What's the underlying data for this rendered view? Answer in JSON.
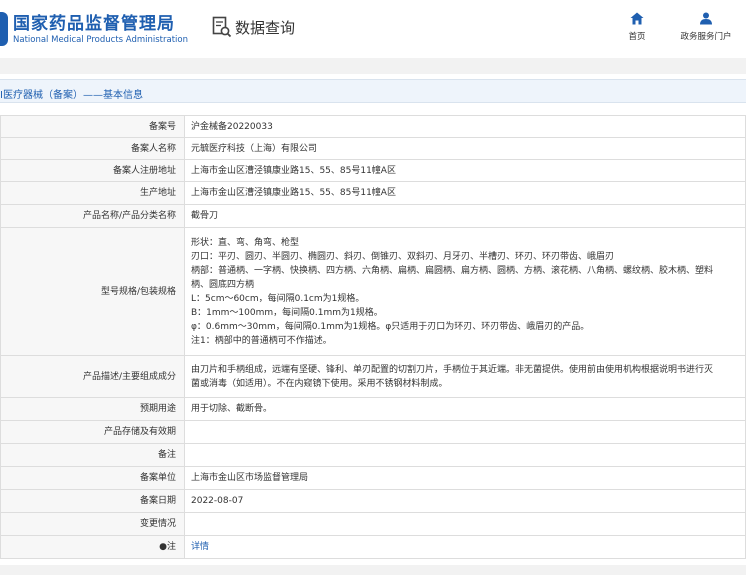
{
  "header": {
    "logo_cn": "国家药品监督管理局",
    "logo_en": "National Medical Products Administration",
    "search_title": "数据查询",
    "nav": {
      "home": "首页",
      "user_portal": "政务服务门户"
    },
    "brand_color": "#1f5fb0"
  },
  "section": {
    "title": "I医疗器械（备案）——基本信息"
  },
  "rows": [
    {
      "label": "备案号",
      "value": "沪金械备20220033"
    },
    {
      "label": "备案人名称",
      "value": "元毓医疗科技（上海）有限公司"
    },
    {
      "label": "备案人注册地址",
      "value": "上海市金山区漕泾镇康业路15、55、85号11幢A区"
    },
    {
      "label": "生产地址",
      "value": "上海市金山区漕泾镇康业路15、55、85号11幢A区"
    },
    {
      "label": "产品名称/产品分类名称",
      "value": "截骨刀"
    },
    {
      "label": "型号规格/包装规格",
      "lines": [
        "形状：直、弯、角弯、枪型",
        "刃口：平刃、圆刃、半圆刃、椭圆刃、斜刃、倒锥刃、双斜刃、月牙刃、半槽刃、环刃、环刃带齿、峨眉刃",
        "柄部：普通柄、一字柄、快换柄、四方柄、六角柄、扁柄、扁圆柄、扁方柄、圆柄、方柄、滚花柄、八角柄、螺纹柄、胶木柄、塑料",
        "柄、圆底四方柄",
        "L：5cm～60cm，每间隔0.1cm为1规格。",
        "B：1mm～100mm，每间隔0.1mm为1规格。",
        "φ：0.6mm～30mm，每间隔0.1mm为1规格。φ只适用于刃口为环刃、环刃带齿、峨眉刃的产品。",
        "注1：柄部中的普通柄可不作描述。"
      ]
    },
    {
      "label": "产品描述/主要组成成分",
      "lines": [
        "由刀片和手柄组成，远端有坚硬、锋利、单刃配置的切割刀片，手柄位于其近端。非无菌提供。使用前由使用机构根据说明书进行灭",
        "菌或消毒（如适用）。不在内窥镜下使用。采用不锈钢材料制成。"
      ]
    },
    {
      "label": "预期用途",
      "value": "用于切除、截断骨。"
    },
    {
      "label": "产品存储及有效期",
      "value": ""
    },
    {
      "label": "备注",
      "value": ""
    },
    {
      "label": "备案单位",
      "value": "上海市金山区市场监督管理局"
    },
    {
      "label": "备案日期",
      "value": "2022-08-07"
    },
    {
      "label": "变更情况",
      "value": ""
    },
    {
      "label": "●注",
      "value": "详情"
    }
  ]
}
